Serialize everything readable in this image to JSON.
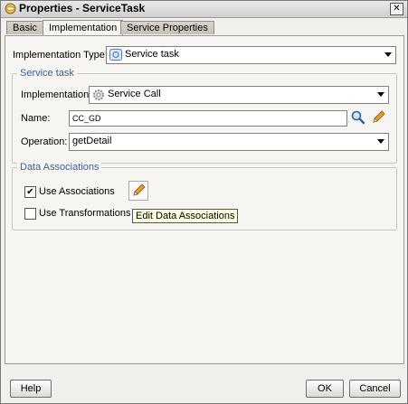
{
  "window": {
    "title": "Properties - ServiceTask"
  },
  "tabs": [
    {
      "label": "Basic",
      "active": false
    },
    {
      "label": "Implementation",
      "active": true
    },
    {
      "label": "Service Properties",
      "active": false
    }
  ],
  "implementation_type": {
    "label": "Implementation Type:",
    "value": "Service task",
    "icon": "service-task-icon"
  },
  "service_task": {
    "title": "Service task",
    "implementation": {
      "label": "Implementation:",
      "value": "Service Call",
      "icon": "gear-icon"
    },
    "name": {
      "label": "Name:",
      "value": "CC_GD"
    },
    "operation": {
      "label": "Operation:",
      "value": "getDetail"
    }
  },
  "data_associations": {
    "title": "Data Associations",
    "use_associations": {
      "label": "Use Associations",
      "checked": true
    },
    "use_transformations": {
      "label": "Use Transformations",
      "checked": false
    },
    "edit_tooltip": "Edit Data Associations"
  },
  "footer": {
    "help": "Help",
    "ok": "OK",
    "cancel": "Cancel"
  },
  "colors": {
    "group_title": "#3a5f9e",
    "tooltip_bg": "#ffffe1",
    "window_bg": "#f1f0ec"
  }
}
